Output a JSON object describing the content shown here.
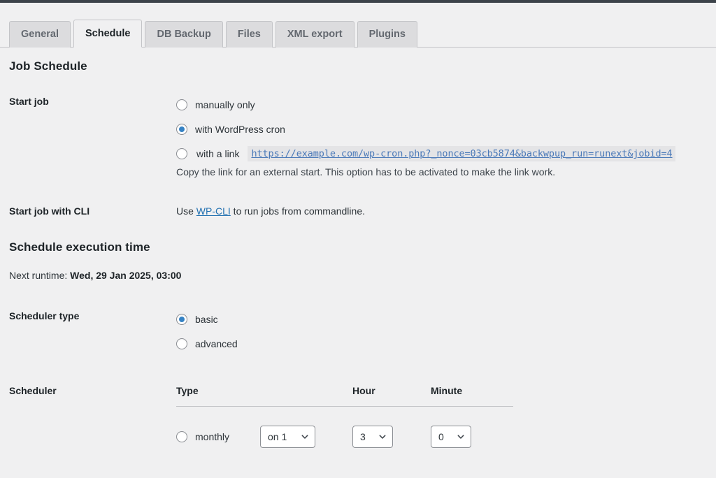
{
  "tabs": [
    {
      "label": "General",
      "active": false
    },
    {
      "label": "Schedule",
      "active": true
    },
    {
      "label": "DB Backup",
      "active": false
    },
    {
      "label": "Files",
      "active": false
    },
    {
      "label": "XML export",
      "active": false
    },
    {
      "label": "Plugins",
      "active": false
    }
  ],
  "job_schedule": {
    "title": "Job Schedule",
    "start_job": {
      "label": "Start job",
      "options": [
        {
          "label": "manually only",
          "checked": false
        },
        {
          "label": "with WordPress cron",
          "checked": true
        },
        {
          "label": "with a link",
          "checked": false
        }
      ],
      "link_url": "https://example.com/wp-cron.php?_nonce=03cb5874&backwpup_run=runext&jobid=4",
      "hint": "Copy the link for an external start. This option has to be activated to make the link work."
    },
    "start_job_cli": {
      "label": "Start job with CLI",
      "text_before": "Use ",
      "link_label": "WP-CLI",
      "text_after": " to run jobs from commandline."
    }
  },
  "schedule_execution": {
    "title": "Schedule execution time",
    "next_runtime_label": "Next runtime: ",
    "next_runtime_value": "Wed, 29 Jan 2025, 03:00",
    "scheduler_type": {
      "label": "Scheduler type",
      "options": [
        {
          "label": "basic",
          "checked": true
        },
        {
          "label": "advanced",
          "checked": false
        }
      ]
    },
    "scheduler": {
      "label": "Scheduler",
      "columns": {
        "type": "Type",
        "hour": "Hour",
        "minute": "Minute"
      },
      "rows": [
        {
          "type_label": "monthly",
          "type_checked": false,
          "type_value": "on 1",
          "hour_value": "3",
          "minute_value": "0"
        }
      ]
    }
  },
  "icons": {
    "chevron_down": "chevron-down-icon"
  },
  "colors": {
    "accent": "#2271b1",
    "radio_selected": "#3582c4",
    "page_bg": "#f0f0f1",
    "tab_inactive_bg": "#dcdcde",
    "border": "#c3c4c7",
    "admin_bar": "#3c434a"
  }
}
